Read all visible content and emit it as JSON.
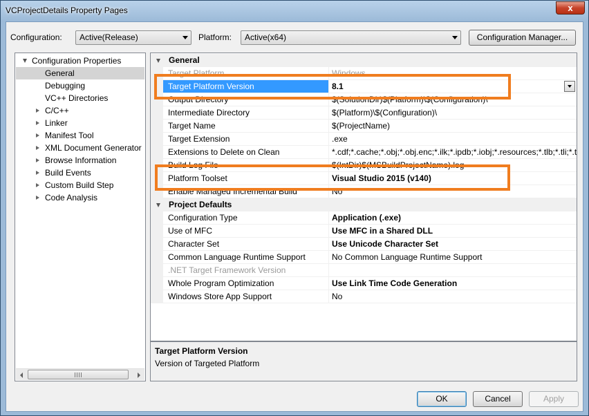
{
  "window": {
    "title": "VCProjectDetails Property Pages",
    "close_glyph": "x"
  },
  "toolbar": {
    "configuration_label": "Configuration:",
    "configuration_value": "Active(Release)",
    "platform_label": "Platform:",
    "platform_value": "Active(x64)",
    "config_manager_label": "Configuration Manager..."
  },
  "tree": {
    "root": "Configuration Properties",
    "items": [
      {
        "label": "General",
        "selected": true,
        "expandable": false
      },
      {
        "label": "Debugging",
        "expandable": false
      },
      {
        "label": "VC++ Directories",
        "expandable": false
      },
      {
        "label": "C/C++",
        "expandable": true
      },
      {
        "label": "Linker",
        "expandable": true
      },
      {
        "label": "Manifest Tool",
        "expandable": true
      },
      {
        "label": "XML Document Generator",
        "expandable": true
      },
      {
        "label": "Browse Information",
        "expandable": true
      },
      {
        "label": "Build Events",
        "expandable": true
      },
      {
        "label": "Custom Build Step",
        "expandable": true
      },
      {
        "label": "Code Analysis",
        "expandable": true
      }
    ]
  },
  "grid": {
    "categories": [
      {
        "label": "General"
      },
      {
        "label": "Project Defaults"
      }
    ],
    "general_rows": [
      {
        "name": "Target Platform",
        "value": "Windows",
        "disabled": true
      },
      {
        "name": "Target Platform Version",
        "value": "8.1",
        "bold": true,
        "selected": true
      },
      {
        "name": "Output Directory",
        "value": "$(SolutionDir)$(Platform)\\$(Configuration)\\"
      },
      {
        "name": "Intermediate Directory",
        "value": "$(Platform)\\$(Configuration)\\"
      },
      {
        "name": "Target Name",
        "value": "$(ProjectName)"
      },
      {
        "name": "Target Extension",
        "value": ".exe"
      },
      {
        "name": "Extensions to Delete on Clean",
        "value": "*.cdf;*.cache;*.obj;*.obj.enc;*.ilk;*.ipdb;*.iobj;*.resources;*.tlb;*.tli;*.t"
      },
      {
        "name": "Build Log File",
        "value": "$(IntDir)$(MSBuildProjectName).log"
      },
      {
        "name": "Platform Toolset",
        "value": "Visual Studio 2015 (v140)",
        "bold": true
      },
      {
        "name": "Enable Managed Incremental Build",
        "value": "No"
      }
    ],
    "defaults_rows": [
      {
        "name": "Configuration Type",
        "value": "Application (.exe)",
        "bold": true
      },
      {
        "name": "Use of MFC",
        "value": "Use MFC in a Shared DLL",
        "bold": true
      },
      {
        "name": "Character Set",
        "value": "Use Unicode Character Set",
        "bold": true
      },
      {
        "name": "Common Language Runtime Support",
        "value": "No Common Language Runtime Support"
      },
      {
        "name": ".NET Target Framework Version",
        "value": "",
        "disabled": true
      },
      {
        "name": "Whole Program Optimization",
        "value": "Use Link Time Code Generation",
        "bold": true
      },
      {
        "name": "Windows Store App Support",
        "value": "No"
      }
    ]
  },
  "description": {
    "title": "Target Platform Version",
    "text": "Version of Targeted Platform"
  },
  "buttons": {
    "ok": "OK",
    "cancel": "Cancel",
    "apply": "Apply"
  },
  "colors": {
    "highlight": "#f07d1f",
    "selection": "#3399ff"
  }
}
